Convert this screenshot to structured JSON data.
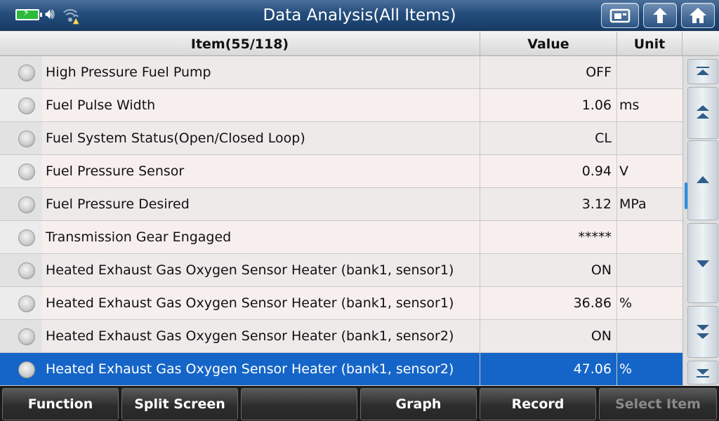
{
  "header": {
    "title": "Data Analysis(All Items)"
  },
  "table": {
    "columns": {
      "item": "Item(55/118)",
      "value": "Value",
      "unit": "Unit"
    },
    "rows": [
      {
        "label": "High Pressure Fuel Pump",
        "value": "OFF",
        "unit": ""
      },
      {
        "label": "Fuel Pulse Width",
        "value": "1.06",
        "unit": "ms"
      },
      {
        "label": "Fuel System Status(Open/Closed Loop)",
        "value": "CL",
        "unit": ""
      },
      {
        "label": "Fuel Pressure Sensor",
        "value": "0.94",
        "unit": "V"
      },
      {
        "label": "Fuel Pressure Desired",
        "value": "3.12",
        "unit": "MPa"
      },
      {
        "label": "Transmission Gear Engaged",
        "value": "*****",
        "unit": ""
      },
      {
        "label": "Heated Exhaust Gas Oxygen Sensor Heater (bank1, sensor1)",
        "value": "ON",
        "unit": ""
      },
      {
        "label": "Heated Exhaust Gas Oxygen Sensor Heater (bank1, sensor1)",
        "value": "36.86",
        "unit": "%"
      },
      {
        "label": "Heated Exhaust Gas Oxygen Sensor Heater (bank1, sensor2)",
        "value": "ON",
        "unit": ""
      },
      {
        "label": "Heated Exhaust Gas Oxygen Sensor Heater (bank1, sensor2)",
        "value": "47.06",
        "unit": "%"
      }
    ]
  },
  "toolbar": {
    "function": "Function",
    "split_screen": "Split Screen",
    "blank": "",
    "graph": "Graph",
    "record": "Record",
    "select_item": "Select Item"
  },
  "icons": {
    "status": [
      "battery-charging-icon",
      "speaker-icon",
      "wifi-warning-icon"
    ],
    "top": [
      "screenshot-icon",
      "back-icon",
      "home-icon"
    ],
    "scroll": [
      "scroll-top-icon",
      "page-up-icon",
      "scroll-up-icon",
      "scroll-down-icon",
      "page-down-icon",
      "scroll-bottom-icon"
    ]
  },
  "colors": {
    "title_bar": "#244d7c",
    "selected_row": "#1565c8",
    "battery": "#2bbb3a",
    "scroll_thumb": "#2a8be0"
  }
}
